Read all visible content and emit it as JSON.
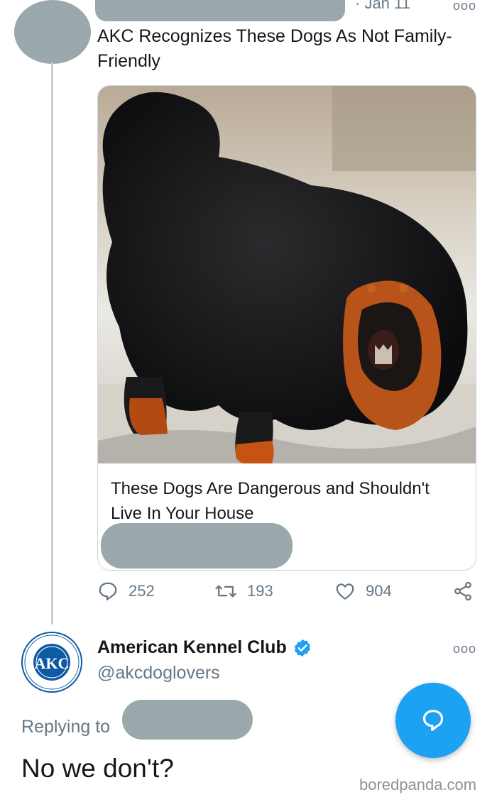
{
  "tweet": {
    "date": "· Jan 11",
    "text": "AKC Recognizes These Dogs As Not Family-Friendly",
    "more": "ooo",
    "card": {
      "title": "These Dogs Are Dangerous and Shouldn't Live In Your House"
    },
    "actions": {
      "replies": "252",
      "retweets": "193",
      "likes": "904"
    }
  },
  "reply": {
    "name": "American Kennel Club",
    "handle": "@akcdoglovers",
    "more": "ooo",
    "replying_label": "Replying to",
    "text": "No we don't?",
    "avatar_text": "AKC"
  },
  "watermark": "boredpanda.com",
  "colors": {
    "accent": "#1da1f2",
    "secondary_text": "#657786",
    "primary_text": "#14171a",
    "border": "#ccd6dd",
    "verified": "#1da1f2",
    "akc_blue": "#0f5aa5"
  },
  "icons": [
    "reply-icon",
    "retweet-icon",
    "like-icon",
    "share-icon",
    "verified-badge-icon",
    "compose-reply-icon"
  ]
}
